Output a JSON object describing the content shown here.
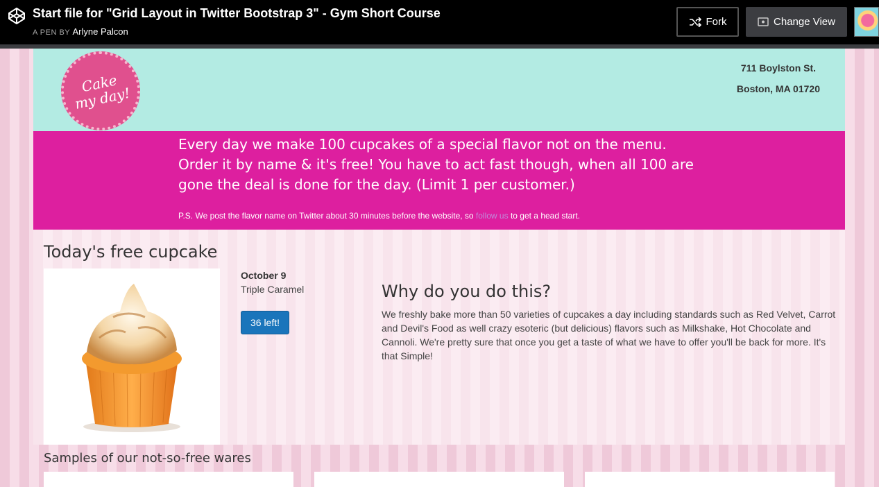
{
  "codepen": {
    "title": "Start file for \"Grid Layout in Twitter Bootstrap 3\" - Gym Short Course",
    "byline_prefix": "A PEN BY",
    "author": "Arlyne Palcon",
    "fork_label": "Fork",
    "change_view_label": "Change View",
    "logo_icon": "codepen-logo-icon",
    "avatar": "user-avatar"
  },
  "hero": {
    "logo_line1": "Cake",
    "logo_line2": "my day!",
    "address_line1": "711 Boylston St.",
    "address_line2": "Boston, MA 01720"
  },
  "promo": {
    "main": "Every day we make 100 cupcakes of a special flavor not on the menu. Order it by name & it's free! You have to act fast though, when all 100 are gone the deal is done for the day. (Limit 1 per customer.)",
    "note_prefix": "P.S. We post the flavor name on Twitter about 30 minutes before the website, so",
    "note_link": "follow us",
    "note_suffix": "to get a head start."
  },
  "today": {
    "title": "Today's free cupcake",
    "date": "October 9",
    "flavor": "Triple Caramel",
    "left_badge": "36 left!",
    "why_title": "Why do you do this?",
    "why_body": "We freshly bake more than 50 varieties of cupcakes a day including standards such as Red Velvet, Carrot and Devil's Food as well crazy esoteric (but delicious) flavors such as Milkshake, Hot Chocolate and Cannoli. We're pretty sure that once you get a taste of what we have to offer you'll be back for more. It's that Simple!"
  },
  "samples": {
    "title": "Samples of our not-so-free wares"
  },
  "colors": {
    "hero_bg": "#b3ebe3",
    "promo_bg": "#dd1f9f",
    "badge_bg": "#1a75bb",
    "logo_pink": "#e0508e"
  }
}
